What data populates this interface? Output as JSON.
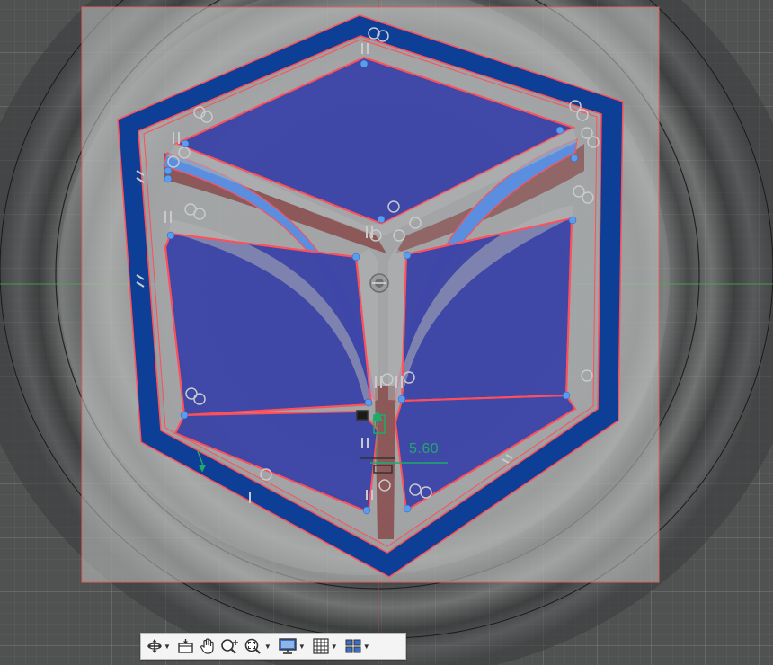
{
  "viewport": {
    "dimension_value": "5.60",
    "colors": {
      "sketch_fill": "#3b43a6",
      "border_fill": "#0d3f96",
      "profile_line": "#ff4f5a",
      "constraint_point": "#5a9cf0",
      "dimension": "#1faa6a",
      "canvas": "#505252"
    }
  },
  "toolbar": {
    "buttons": [
      {
        "name": "orbit-icon",
        "has_menu": true
      },
      {
        "name": "look-at-icon",
        "has_menu": false
      },
      {
        "name": "pan-icon",
        "has_menu": false
      },
      {
        "name": "zoom-icon",
        "has_menu": false
      },
      {
        "name": "fit-icon",
        "has_menu": true
      },
      {
        "name": "display-settings-icon",
        "has_menu": true
      },
      {
        "name": "grid-snaps-icon",
        "has_menu": true
      },
      {
        "name": "viewports-icon",
        "has_menu": true
      }
    ]
  }
}
